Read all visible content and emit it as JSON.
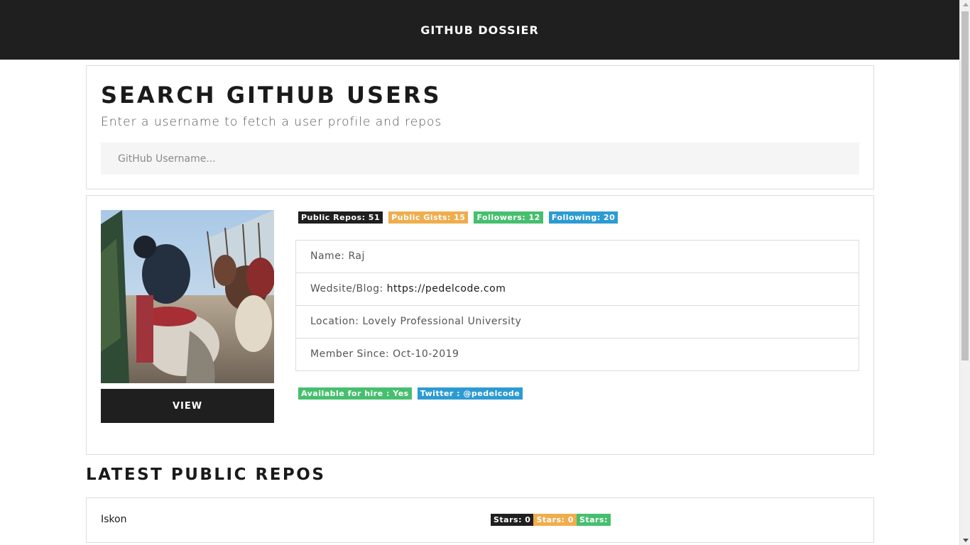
{
  "navbar": {
    "brand": "GITHUB DOSSIER"
  },
  "search": {
    "title": "SEARCH GITHUB USERS",
    "subtitle": "Enter a username to fetch a user profile and repos",
    "placeholder": "GitHub Username..."
  },
  "profile": {
    "view_label": "VIEW",
    "badges": [
      "Public Repos: 51",
      "Public Gists: 15",
      "Followers: 12",
      "Following: 20"
    ],
    "name_label": "Name: Raj",
    "website_label": "Wedsite/Blog: ",
    "website_url": "https://pedelcode.com",
    "location_label": "Location: Lovely Professional University",
    "member_since_label": "Member Since: Oct-10-2019",
    "hire_badge": "Available for hire : Yes",
    "twitter_badge": "Twitter : @pedelcode"
  },
  "repos": {
    "title": "LATEST PUBLIC REPOS",
    "items": [
      {
        "name": "Iskon",
        "badges": [
          "Stars: 0",
          "Stars: 0",
          "Stars:"
        ]
      }
    ]
  },
  "colors": {
    "navbar": "#1f1f1f",
    "badge_dark": "#1f1f1f",
    "badge_orange": "#f0ad4e",
    "badge_green": "#46bf6e",
    "badge_blue": "#2d9bd2"
  }
}
